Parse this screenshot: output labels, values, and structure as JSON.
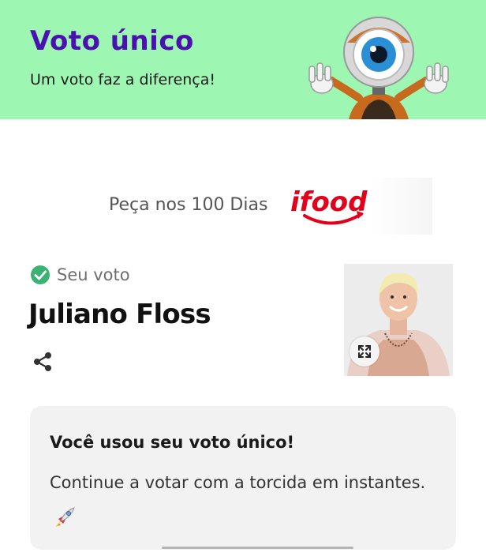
{
  "header": {
    "title": "Voto único",
    "subtitle": "Um voto faz a diferença!",
    "mascot_icon": "big-brother-eye-mascot-icon"
  },
  "sponsor": {
    "label": "Peça nos 100 Dias",
    "logo_text": "ifood",
    "logo_color": "#e3001b"
  },
  "vote": {
    "status_label": "Seu voto",
    "status_icon": "check-circle-icon",
    "status_color": "#3bb273",
    "candidate_name": "Juliano Floss",
    "share_icon": "share-icon",
    "expand_icon": "expand-icon"
  },
  "notice": {
    "title": "Você usou seu voto único!",
    "body": "Continue a votar com a torcida em instantes.",
    "emoji_icon": "rocket-icon"
  },
  "colors": {
    "header_bg": "#9df7b3",
    "title": "#4a10b0",
    "card_bg": "#f2f2f2"
  }
}
